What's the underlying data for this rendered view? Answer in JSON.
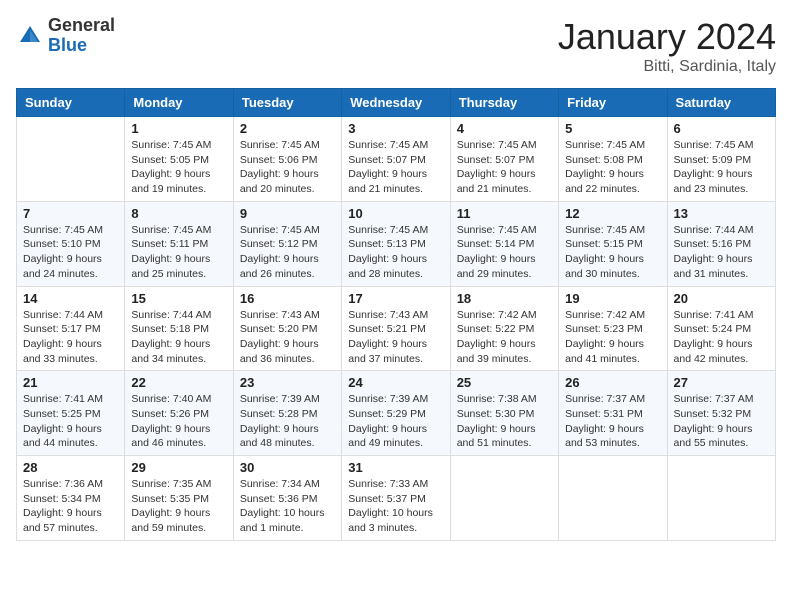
{
  "header": {
    "logo_general": "General",
    "logo_blue": "Blue",
    "month": "January 2024",
    "location": "Bitti, Sardinia, Italy"
  },
  "days_of_week": [
    "Sunday",
    "Monday",
    "Tuesday",
    "Wednesday",
    "Thursday",
    "Friday",
    "Saturday"
  ],
  "weeks": [
    [
      {
        "day": "",
        "sunrise": "",
        "sunset": "",
        "daylight": ""
      },
      {
        "day": "1",
        "sunrise": "Sunrise: 7:45 AM",
        "sunset": "Sunset: 5:05 PM",
        "daylight": "Daylight: 9 hours and 19 minutes."
      },
      {
        "day": "2",
        "sunrise": "Sunrise: 7:45 AM",
        "sunset": "Sunset: 5:06 PM",
        "daylight": "Daylight: 9 hours and 20 minutes."
      },
      {
        "day": "3",
        "sunrise": "Sunrise: 7:45 AM",
        "sunset": "Sunset: 5:07 PM",
        "daylight": "Daylight: 9 hours and 21 minutes."
      },
      {
        "day": "4",
        "sunrise": "Sunrise: 7:45 AM",
        "sunset": "Sunset: 5:07 PM",
        "daylight": "Daylight: 9 hours and 21 minutes."
      },
      {
        "day": "5",
        "sunrise": "Sunrise: 7:45 AM",
        "sunset": "Sunset: 5:08 PM",
        "daylight": "Daylight: 9 hours and 22 minutes."
      },
      {
        "day": "6",
        "sunrise": "Sunrise: 7:45 AM",
        "sunset": "Sunset: 5:09 PM",
        "daylight": "Daylight: 9 hours and 23 minutes."
      }
    ],
    [
      {
        "day": "7",
        "sunrise": "Sunrise: 7:45 AM",
        "sunset": "Sunset: 5:10 PM",
        "daylight": "Daylight: 9 hours and 24 minutes."
      },
      {
        "day": "8",
        "sunrise": "Sunrise: 7:45 AM",
        "sunset": "Sunset: 5:11 PM",
        "daylight": "Daylight: 9 hours and 25 minutes."
      },
      {
        "day": "9",
        "sunrise": "Sunrise: 7:45 AM",
        "sunset": "Sunset: 5:12 PM",
        "daylight": "Daylight: 9 hours and 26 minutes."
      },
      {
        "day": "10",
        "sunrise": "Sunrise: 7:45 AM",
        "sunset": "Sunset: 5:13 PM",
        "daylight": "Daylight: 9 hours and 28 minutes."
      },
      {
        "day": "11",
        "sunrise": "Sunrise: 7:45 AM",
        "sunset": "Sunset: 5:14 PM",
        "daylight": "Daylight: 9 hours and 29 minutes."
      },
      {
        "day": "12",
        "sunrise": "Sunrise: 7:45 AM",
        "sunset": "Sunset: 5:15 PM",
        "daylight": "Daylight: 9 hours and 30 minutes."
      },
      {
        "day": "13",
        "sunrise": "Sunrise: 7:44 AM",
        "sunset": "Sunset: 5:16 PM",
        "daylight": "Daylight: 9 hours and 31 minutes."
      }
    ],
    [
      {
        "day": "14",
        "sunrise": "Sunrise: 7:44 AM",
        "sunset": "Sunset: 5:17 PM",
        "daylight": "Daylight: 9 hours and 33 minutes."
      },
      {
        "day": "15",
        "sunrise": "Sunrise: 7:44 AM",
        "sunset": "Sunset: 5:18 PM",
        "daylight": "Daylight: 9 hours and 34 minutes."
      },
      {
        "day": "16",
        "sunrise": "Sunrise: 7:43 AM",
        "sunset": "Sunset: 5:20 PM",
        "daylight": "Daylight: 9 hours and 36 minutes."
      },
      {
        "day": "17",
        "sunrise": "Sunrise: 7:43 AM",
        "sunset": "Sunset: 5:21 PM",
        "daylight": "Daylight: 9 hours and 37 minutes."
      },
      {
        "day": "18",
        "sunrise": "Sunrise: 7:42 AM",
        "sunset": "Sunset: 5:22 PM",
        "daylight": "Daylight: 9 hours and 39 minutes."
      },
      {
        "day": "19",
        "sunrise": "Sunrise: 7:42 AM",
        "sunset": "Sunset: 5:23 PM",
        "daylight": "Daylight: 9 hours and 41 minutes."
      },
      {
        "day": "20",
        "sunrise": "Sunrise: 7:41 AM",
        "sunset": "Sunset: 5:24 PM",
        "daylight": "Daylight: 9 hours and 42 minutes."
      }
    ],
    [
      {
        "day": "21",
        "sunrise": "Sunrise: 7:41 AM",
        "sunset": "Sunset: 5:25 PM",
        "daylight": "Daylight: 9 hours and 44 minutes."
      },
      {
        "day": "22",
        "sunrise": "Sunrise: 7:40 AM",
        "sunset": "Sunset: 5:26 PM",
        "daylight": "Daylight: 9 hours and 46 minutes."
      },
      {
        "day": "23",
        "sunrise": "Sunrise: 7:39 AM",
        "sunset": "Sunset: 5:28 PM",
        "daylight": "Daylight: 9 hours and 48 minutes."
      },
      {
        "day": "24",
        "sunrise": "Sunrise: 7:39 AM",
        "sunset": "Sunset: 5:29 PM",
        "daylight": "Daylight: 9 hours and 49 minutes."
      },
      {
        "day": "25",
        "sunrise": "Sunrise: 7:38 AM",
        "sunset": "Sunset: 5:30 PM",
        "daylight": "Daylight: 9 hours and 51 minutes."
      },
      {
        "day": "26",
        "sunrise": "Sunrise: 7:37 AM",
        "sunset": "Sunset: 5:31 PM",
        "daylight": "Daylight: 9 hours and 53 minutes."
      },
      {
        "day": "27",
        "sunrise": "Sunrise: 7:37 AM",
        "sunset": "Sunset: 5:32 PM",
        "daylight": "Daylight: 9 hours and 55 minutes."
      }
    ],
    [
      {
        "day": "28",
        "sunrise": "Sunrise: 7:36 AM",
        "sunset": "Sunset: 5:34 PM",
        "daylight": "Daylight: 9 hours and 57 minutes."
      },
      {
        "day": "29",
        "sunrise": "Sunrise: 7:35 AM",
        "sunset": "Sunset: 5:35 PM",
        "daylight": "Daylight: 9 hours and 59 minutes."
      },
      {
        "day": "30",
        "sunrise": "Sunrise: 7:34 AM",
        "sunset": "Sunset: 5:36 PM",
        "daylight": "Daylight: 10 hours and 1 minute."
      },
      {
        "day": "31",
        "sunrise": "Sunrise: 7:33 AM",
        "sunset": "Sunset: 5:37 PM",
        "daylight": "Daylight: 10 hours and 3 minutes."
      },
      {
        "day": "",
        "sunrise": "",
        "sunset": "",
        "daylight": ""
      },
      {
        "day": "",
        "sunrise": "",
        "sunset": "",
        "daylight": ""
      },
      {
        "day": "",
        "sunrise": "",
        "sunset": "",
        "daylight": ""
      }
    ]
  ]
}
